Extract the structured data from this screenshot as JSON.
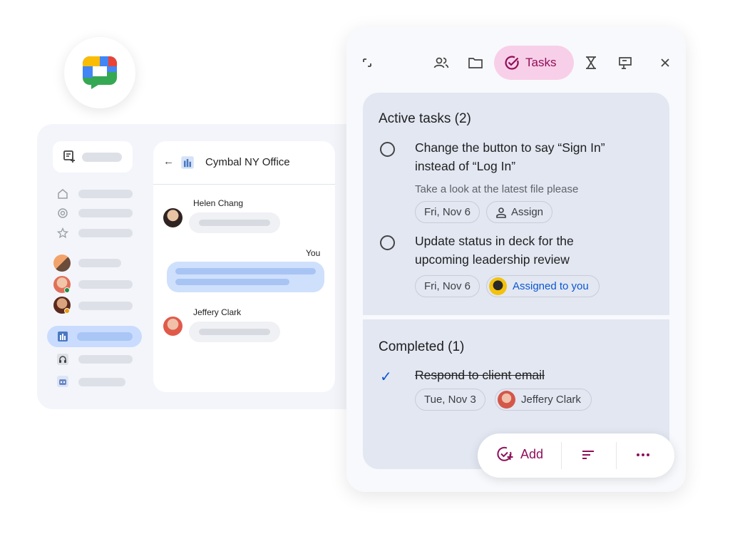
{
  "brand": {
    "logo": "google-chat-logo",
    "colors": {
      "blue": "#4285f4",
      "green": "#34a853",
      "yellow": "#fbbc04",
      "red": "#ea4335"
    }
  },
  "chat": {
    "room_title": "Cymbal NY Office",
    "messages": [
      {
        "sender": "Helen Chang"
      },
      {
        "sender": "You"
      },
      {
        "sender": "Jeffery Clark"
      }
    ]
  },
  "panel": {
    "tabs": {
      "active_label": "Tasks"
    },
    "active_section": {
      "heading": "Active tasks (2)",
      "tasks": [
        {
          "title_line1": "Change the button to say “Sign In”",
          "title_line2": "instead of “Log In”",
          "description": "Take a look at the latest file please",
          "date": "Fri, Nov 6",
          "assign_label": "Assign"
        },
        {
          "title_line1": "Update status in deck for the",
          "title_line2": "upcoming leadership review",
          "date": "Fri, Nov 6",
          "assignee": "Assigned to you"
        }
      ]
    },
    "completed_section": {
      "heading": "Completed (1)",
      "tasks": [
        {
          "title": "Respond to client email",
          "date": "Tue, Nov 3",
          "assignee": "Jeffery Clark"
        }
      ]
    },
    "actions": {
      "add_label": "Add"
    }
  },
  "accent": {
    "tasks_pink": "#f8cfe8",
    "tasks_text": "#8e0f5a",
    "link_blue": "#0b57d0"
  }
}
